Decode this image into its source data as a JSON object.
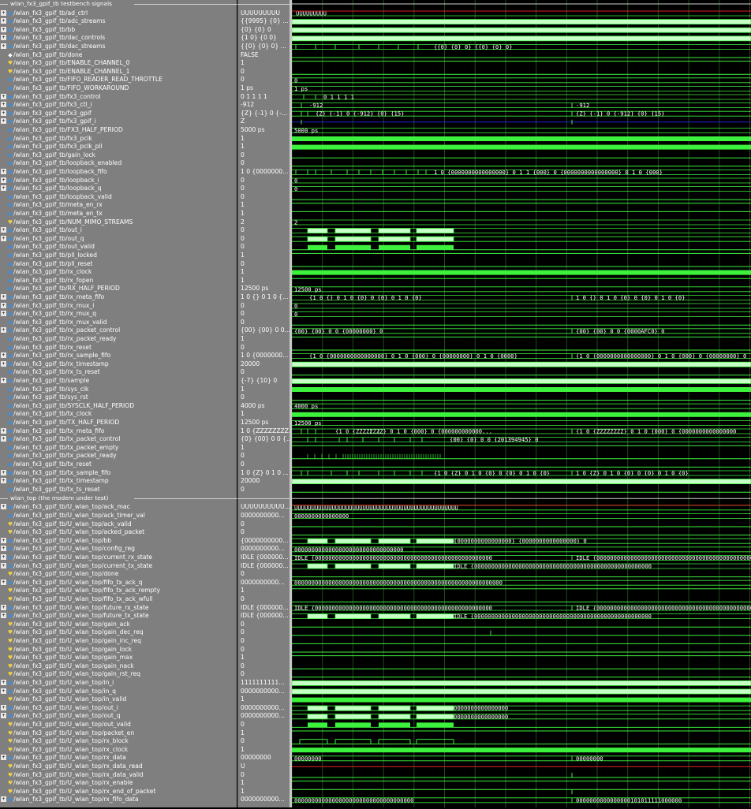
{
  "tb_group_label": "wlan_fx3_gpif_tb testbench signals",
  "dut_group_label": "wlan_top (the modem under test)",
  "colors": {
    "wave_green": "#3df23d",
    "bus_fill": "#c8ffc8",
    "bus_edge": "#3df23d",
    "undef_red": "#e02020",
    "hiz_blue": "#2020d0",
    "grid": "#1e4a1e",
    "panel": "#7f7f7f"
  },
  "tb_signals": [
    {
      "name": "/wlan_fx3_gpif_tb/ad_ctrl",
      "value": "UUUUUUUUU",
      "kind": "vec",
      "exp": true
    },
    {
      "name": "/wlan_fx3_gpif_tb/adc_streams",
      "value": "{{9995} {0} ...",
      "kind": "vec",
      "exp": true
    },
    {
      "name": "/wlan_fx3_gpif_tb/bb",
      "value": "{0} {0} 0",
      "kind": "vec",
      "exp": true
    },
    {
      "name": "/wlan_fx3_gpif_tb/dac_controls",
      "value": "{1 0} {0 0}",
      "kind": "vec",
      "exp": true
    },
    {
      "name": "/wlan_fx3_gpif_tb/dac_streams",
      "value": "{{0} {0} 0} ...",
      "kind": "vec",
      "exp": true
    },
    {
      "name": "/wlan_fx3_gpif_tb/done",
      "value": "FALSE",
      "kind": "txt",
      "exp": false
    },
    {
      "name": "/wlan_fx3_gpif_tb/ENABLE_CHANNEL_0",
      "value": "1",
      "kind": "bit",
      "exp": false
    },
    {
      "name": "/wlan_fx3_gpif_tb/ENABLE_CHANNEL_1",
      "value": "0",
      "kind": "bit",
      "exp": false
    },
    {
      "name": "/wlan_fx3_gpif_tb/FIFO_READER_READ_THROTTLE",
      "value": "0",
      "kind": "vec",
      "exp": false
    },
    {
      "name": "/wlan_fx3_gpif_tb/FIFO_WORKAROUND",
      "value": "1 ps",
      "kind": "vec",
      "exp": false
    },
    {
      "name": "/wlan_fx3_gpif_tb/fx3_control",
      "value": "0 1 1 1 1",
      "kind": "vec",
      "exp": true
    },
    {
      "name": "/wlan_fx3_gpif_tb/fx3_ctl_i",
      "value": "-912",
      "kind": "vec",
      "exp": true
    },
    {
      "name": "/wlan_fx3_gpif_tb/fx3_gpif",
      "value": "{Z} {-1} 0 {-...",
      "kind": "vec",
      "exp": true
    },
    {
      "name": "/wlan_fx3_gpif_tb/fx3_gpif_i",
      "value": "Z",
      "kind": "vec",
      "exp": true
    },
    {
      "name": "/wlan_fx3_gpif_tb/FX3_HALF_PERIOD",
      "value": "5000 ps",
      "kind": "vec",
      "exp": false
    },
    {
      "name": "/wlan_fx3_gpif_tb/fx3_pclk",
      "value": "1",
      "kind": "vec",
      "exp": false
    },
    {
      "name": "/wlan_fx3_gpif_tb/fx3_pclk_pll",
      "value": "1",
      "kind": "vec",
      "exp": false
    },
    {
      "name": "/wlan_fx3_gpif_tb/gain_lock",
      "value": "0",
      "kind": "vec",
      "exp": false
    },
    {
      "name": "/wlan_fx3_gpif_tb/loopback_enabled",
      "value": "0",
      "kind": "vec",
      "exp": false
    },
    {
      "name": "/wlan_fx3_gpif_tb/loopback_fifo",
      "value": "1 0 {0000000...",
      "kind": "vec",
      "exp": true
    },
    {
      "name": "/wlan_fx3_gpif_tb/loopback_i",
      "value": "0",
      "kind": "vec",
      "exp": true
    },
    {
      "name": "/wlan_fx3_gpif_tb/loopback_q",
      "value": "0",
      "kind": "vec",
      "exp": true
    },
    {
      "name": "/wlan_fx3_gpif_tb/loopback_valid",
      "value": "0",
      "kind": "vec",
      "exp": false
    },
    {
      "name": "/wlan_fx3_gpif_tb/meta_en_rx",
      "value": "1",
      "kind": "vec",
      "exp": false
    },
    {
      "name": "/wlan_fx3_gpif_tb/meta_en_tx",
      "value": "1",
      "kind": "vec",
      "exp": false
    },
    {
      "name": "/wlan_fx3_gpif_tb/NUM_MIMO_STREAMS",
      "value": "2",
      "kind": "bit",
      "exp": false
    },
    {
      "name": "/wlan_fx3_gpif_tb/out_i",
      "value": "0",
      "kind": "vec",
      "exp": true
    },
    {
      "name": "/wlan_fx3_gpif_tb/out_q",
      "value": "0",
      "kind": "vec",
      "exp": true
    },
    {
      "name": "/wlan_fx3_gpif_tb/out_valid",
      "value": "0",
      "kind": "vec",
      "exp": false
    },
    {
      "name": "/wlan_fx3_gpif_tb/pll_locked",
      "value": "1",
      "kind": "vec",
      "exp": false
    },
    {
      "name": "/wlan_fx3_gpif_tb/pll_reset",
      "value": "0",
      "kind": "vec",
      "exp": false
    },
    {
      "name": "/wlan_fx3_gpif_tb/rx_clock",
      "value": "1",
      "kind": "vec",
      "exp": false
    },
    {
      "name": "/wlan_fx3_gpif_tb/rx_fopen",
      "value": "1",
      "kind": "vec",
      "exp": false
    },
    {
      "name": "/wlan_fx3_gpif_tb/RX_HALF_PERIOD",
      "value": "12500 ps",
      "kind": "vec",
      "exp": false
    },
    {
      "name": "/wlan_fx3_gpif_tb/rx_meta_fifo",
      "value": "1 0 {} 0 1 0 {...",
      "kind": "vec",
      "exp": true
    },
    {
      "name": "/wlan_fx3_gpif_tb/rx_mux_i",
      "value": "0",
      "kind": "vec",
      "exp": true
    },
    {
      "name": "/wlan_fx3_gpif_tb/rx_mux_q",
      "value": "0",
      "kind": "vec",
      "exp": true
    },
    {
      "name": "/wlan_fx3_gpif_tb/rx_mux_valid",
      "value": "0",
      "kind": "vec",
      "exp": false
    },
    {
      "name": "/wlan_fx3_gpif_tb/rx_packet_control",
      "value": "{00} {00} 0 0...",
      "kind": "vec",
      "exp": true
    },
    {
      "name": "/wlan_fx3_gpif_tb/rx_packet_ready",
      "value": "1",
      "kind": "vec",
      "exp": false
    },
    {
      "name": "/wlan_fx3_gpif_tb/rx_reset",
      "value": "0",
      "kind": "vec",
      "exp": false
    },
    {
      "name": "/wlan_fx3_gpif_tb/rx_sample_fifo",
      "value": "1 0 {0000000...",
      "kind": "vec",
      "exp": true
    },
    {
      "name": "/wlan_fx3_gpif_tb/rx_timestamp",
      "value": "20000",
      "kind": "vec",
      "exp": true
    },
    {
      "name": "/wlan_fx3_gpif_tb/rx_ts_reset",
      "value": "0",
      "kind": "vec",
      "exp": false
    },
    {
      "name": "/wlan_fx3_gpif_tb/sample",
      "value": "{-7} {10} 0",
      "kind": "vec",
      "exp": true
    },
    {
      "name": "/wlan_fx3_gpif_tb/sys_clk",
      "value": "1",
      "kind": "vec",
      "exp": false
    },
    {
      "name": "/wlan_fx3_gpif_tb/sys_rst",
      "value": "0",
      "kind": "vec",
      "exp": false
    },
    {
      "name": "/wlan_fx3_gpif_tb/SYSCLK_HALF_PERIOD",
      "value": "4000 ps",
      "kind": "vec",
      "exp": false
    },
    {
      "name": "/wlan_fx3_gpif_tb/tx_clock",
      "value": "1",
      "kind": "vec",
      "exp": false
    },
    {
      "name": "/wlan_fx3_gpif_tb/TX_HALF_PERIOD",
      "value": "12500 ps",
      "kind": "vec",
      "exp": false
    },
    {
      "name": "/wlan_fx3_gpif_tb/tx_meta_fifo",
      "value": "1 0 {ZZZZZZZZ...",
      "kind": "vec",
      "exp": true
    },
    {
      "name": "/wlan_fx3_gpif_tb/tx_packet_control",
      "value": "{0} {00} 0 0 {...",
      "kind": "vec",
      "exp": true
    },
    {
      "name": "/wlan_fx3_gpif_tb/tx_packet_empty",
      "value": "1",
      "kind": "vec",
      "exp": false
    },
    {
      "name": "/wlan_fx3_gpif_tb/tx_packet_ready",
      "value": "0",
      "kind": "vec",
      "exp": false
    },
    {
      "name": "/wlan_fx3_gpif_tb/tx_reset",
      "value": "0",
      "kind": "vec",
      "exp": false
    },
    {
      "name": "/wlan_fx3_gpif_tb/tx_sample_fifo",
      "value": "1 0 {Z} 0 1 0 ...",
      "kind": "vec",
      "exp": true
    },
    {
      "name": "/wlan_fx3_gpif_tb/tx_timestamp",
      "value": "20000",
      "kind": "vec",
      "exp": true
    },
    {
      "name": "/wlan_fx3_gpif_tb/tx_ts_reset",
      "value": "0",
      "kind": "vec",
      "exp": false
    }
  ],
  "dut_signals": [
    {
      "name": "/wlan_fx3_gpif_tb/U_wlan_top/ack_mac",
      "value": "UUUUUUUUUU...",
      "kind": "vec",
      "exp": true
    },
    {
      "name": "/wlan_fx3_gpif_tb/U_wlan_top/ack_timer_val",
      "value": "0000000000...",
      "kind": "vec",
      "exp": false
    },
    {
      "name": "/wlan_fx3_gpif_tb/U_wlan_top/ack_valid",
      "value": "0",
      "kind": "bit",
      "exp": false
    },
    {
      "name": "/wlan_fx3_gpif_tb/U_wlan_top/acked_packet",
      "value": "0",
      "kind": "bit",
      "exp": false
    },
    {
      "name": "/wlan_fx3_gpif_tb/U_wlan_top/bb",
      "value": "{0000000000...",
      "kind": "vec",
      "exp": true
    },
    {
      "name": "/wlan_fx3_gpif_tb/U_wlan_top/config_reg",
      "value": "0000000000...",
      "kind": "vec",
      "exp": true
    },
    {
      "name": "/wlan_fx3_gpif_tb/U_wlan_top/current_rx_state",
      "value": "IDLE {000000...",
      "kind": "vec",
      "exp": true
    },
    {
      "name": "/wlan_fx3_gpif_tb/U_wlan_top/current_tx_state",
      "value": "IDLE {000000...",
      "kind": "vec",
      "exp": true
    },
    {
      "name": "/wlan_fx3_gpif_tb/U_wlan_top/done",
      "value": "0",
      "kind": "bit",
      "exp": false
    },
    {
      "name": "/wlan_fx3_gpif_tb/U_wlan_top/fifo_tx_ack_q",
      "value": "0000000000...",
      "kind": "vec",
      "exp": true
    },
    {
      "name": "/wlan_fx3_gpif_tb/U_wlan_top/fifo_tx_ack_rempty",
      "value": "1",
      "kind": "bit",
      "exp": false
    },
    {
      "name": "/wlan_fx3_gpif_tb/U_wlan_top/fifo_tx_ack_wfull",
      "value": "0",
      "kind": "bit",
      "exp": false
    },
    {
      "name": "/wlan_fx3_gpif_tb/U_wlan_top/future_rx_state",
      "value": "IDLE {000000...",
      "kind": "vec",
      "exp": true
    },
    {
      "name": "/wlan_fx3_gpif_tb/U_wlan_top/future_tx_state",
      "value": "IDLE {000000...",
      "kind": "vec",
      "exp": true
    },
    {
      "name": "/wlan_fx3_gpif_tb/U_wlan_top/gain_ack",
      "value": "0",
      "kind": "bit",
      "exp": false
    },
    {
      "name": "/wlan_fx3_gpif_tb/U_wlan_top/gain_dec_req",
      "value": "0",
      "kind": "bit",
      "exp": false
    },
    {
      "name": "/wlan_fx3_gpif_tb/U_wlan_top/gain_inc_req",
      "value": "0",
      "kind": "bit",
      "exp": false
    },
    {
      "name": "/wlan_fx3_gpif_tb/U_wlan_top/gain_lock",
      "value": "0",
      "kind": "bit",
      "exp": false
    },
    {
      "name": "/wlan_fx3_gpif_tb/U_wlan_top/gain_max",
      "value": "1",
      "kind": "bit",
      "exp": false
    },
    {
      "name": "/wlan_fx3_gpif_tb/U_wlan_top/gain_nack",
      "value": "0",
      "kind": "bit",
      "exp": false
    },
    {
      "name": "/wlan_fx3_gpif_tb/U_wlan_top/gain_rst_req",
      "value": "0",
      "kind": "bit",
      "exp": false
    },
    {
      "name": "/wlan_fx3_gpif_tb/U_wlan_top/in_i",
      "value": "1111111111...",
      "kind": "vec",
      "exp": true
    },
    {
      "name": "/wlan_fx3_gpif_tb/U_wlan_top/in_q",
      "value": "0000000000...",
      "kind": "vec",
      "exp": true
    },
    {
      "name": "/wlan_fx3_gpif_tb/U_wlan_top/in_valid",
      "value": "1",
      "kind": "bit",
      "exp": false
    },
    {
      "name": "/wlan_fx3_gpif_tb/U_wlan_top/out_i",
      "value": "0000000000...",
      "kind": "vec",
      "exp": true
    },
    {
      "name": "/wlan_fx3_gpif_tb/U_wlan_top/out_q",
      "value": "0000000000...",
      "kind": "vec",
      "exp": true
    },
    {
      "name": "/wlan_fx3_gpif_tb/U_wlan_top/out_valid",
      "value": "0",
      "kind": "bit",
      "exp": false
    },
    {
      "name": "/wlan_fx3_gpif_tb/U_wlan_top/packet_en",
      "value": "1",
      "kind": "bit",
      "exp": false
    },
    {
      "name": "/wlan_fx3_gpif_tb/U_wlan_top/rx_block",
      "value": "0",
      "kind": "bit",
      "exp": false
    },
    {
      "name": "/wlan_fx3_gpif_tb/U_wlan_top/rx_clock",
      "value": "1",
      "kind": "bit",
      "exp": false
    },
    {
      "name": "/wlan_fx3_gpif_tb/U_wlan_top/rx_data",
      "value": "00000000",
      "kind": "vec",
      "exp": true
    },
    {
      "name": "/wlan_fx3_gpif_tb/U_wlan_top/rx_data_read",
      "value": "U",
      "kind": "bit",
      "exp": false
    },
    {
      "name": "/wlan_fx3_gpif_tb/U_wlan_top/rx_data_valid",
      "value": "0",
      "kind": "bit",
      "exp": false
    },
    {
      "name": "/wlan_fx3_gpif_tb/U_wlan_top/rx_enable",
      "value": "1",
      "kind": "bit",
      "exp": false
    },
    {
      "name": "/wlan_fx3_gpif_tb/U_wlan_top/rx_end_of_packet",
      "value": "1",
      "kind": "bit",
      "exp": false
    },
    {
      "name": "/wlan_fx3_gpif_tb/U_wlan_top/rx_fifo_data",
      "value": "0000000000...",
      "kind": "vec",
      "exp": true
    }
  ],
  "waveform_labels": {
    "ad_ctrl": "UUUUUUUUU",
    "dac_streams": "{{0} {0} 0} {{0} {0} 0}",
    "fifo_reader_throttle": "0",
    "fifo_workaround": "1 ps",
    "fx3_control": "0 1 1 1 1",
    "fx3_ctl_i_a": "-912",
    "fx3_ctl_i_b": "-912",
    "fx3_gpif_a": "{Z} {-1} 0 {-912} {0} {15}",
    "fx3_gpif_b": "{Z} {-1} 0 {-912} {0} {15}",
    "fx3_half_period": "5000 ps",
    "loopback_fifo": "1 0 {0000000000000000} 0 1 1 {000} 0 {0000000000000000} 0 1 0 {000}",
    "zero": "0",
    "num_mimo": "2",
    "rx_half_period": "12500 ps",
    "rx_meta_fifo_a": "{1 0 {} 0 1 0 {0} 0 {0} 0 1 0 {0}",
    "rx_meta_fifo_b": "1 0 {} 0 1 0 {0} 0 {0} 0 1 0 {0}",
    "rx_packet_control_a": "{00} {00} 0 0 {00000000} 0",
    "rx_packet_control_b": "{00} {00} 0 0 {0000AFC0} 0",
    "rx_sample_fifo_a": "{1 0 {0000000000000000} 0 1 0 {000} 0 {00000000} 0 1 0 {0000}",
    "rx_sample_fifo_b": "{1 0 {0000000000000000} 0 1 0 {000} 0 {00000000} 0",
    "sysclk_half_period": "4000 ps",
    "tx_half_period": "12500 ps",
    "tx_meta_fifo_a": "{1 0 {ZZZZZZZZ} 0 1 0 {000} 0 {000000000000...",
    "tx_meta_fifo_b": "{1 0 {ZZZZZZZZ} 0 1 0 {000} 0 {0000000000000000",
    "tx_packet_control": "{00} {0} 0 0 {201394945} 0",
    "tx_sample_fifo_a": "{1 0 {Z} 0 1 0 {0} 0 {0} 0 1 0 {0}",
    "tx_sample_fifo_b": "1 0 {Z} 0 1 0 {0} 0 {0} 0 1 0 {0}",
    "ack_mac": "UUUUUUUUUUUUUUUUUUUUUUUUUUUUUUUUUUUUUUUUUUUUUUUU",
    "ack_timer_val": "0000000000000000",
    "bb_a": "{0000000000000000} {0000000000000000} 0",
    "config_reg": "00000000000000000000000000000000",
    "idle_state": "IDLE {0000000000000000000000000000000000000000000000000000",
    "fifo_tx_ack_q": "0000000000000000000000000000000000000000000000000000000000000",
    "out_i": "0000000000000000",
    "out_q": "0000000000000000",
    "rx_data": "00000000",
    "rx_fifo_data_a": "00000000000000000000000000000000000",
    "rx_fifo_data_b": "0000000000000000101011111000000"
  }
}
